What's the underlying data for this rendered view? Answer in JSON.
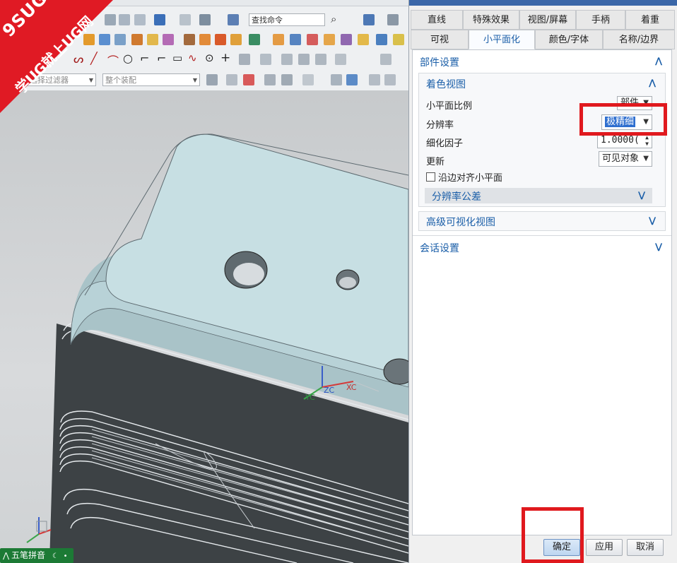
{
  "toolbar": {
    "search_command": "查找命令",
    "filter_placeholder": "选择过滤器",
    "assembly_scope": "整个装配"
  },
  "watermark": {
    "line1": "9SUG",
    "line2": "学UG就上UG网"
  },
  "viewport": {
    "axes": {
      "zc": "ZC",
      "yc": "YC",
      "xc": "XC"
    }
  },
  "ime": {
    "label": "五笔拼音"
  },
  "dialog": {
    "tabs_row1": [
      "直线",
      "特殊效果",
      "视图/屏幕",
      "手柄",
      "着重"
    ],
    "tabs_row2": [
      "可视",
      "小平面化",
      "颜色/字体",
      "名称/边界"
    ],
    "active_tab": "小平面化",
    "part_settings": {
      "title": "部件设置",
      "shaded_view": {
        "title": "着色视图",
        "facet_ratio_label": "小平面比例",
        "facet_ratio_value": "部件",
        "resolution_label": "分辨率",
        "resolution_value": "极精细",
        "refine_factor_label": "细化因子",
        "refine_factor_value": "1.0000(",
        "update_label": "更新",
        "update_value": "可见对象",
        "align_checkbox_label": "沿边对齐小平面",
        "align_checked": false,
        "tolerance_group": "分辨率公差"
      },
      "advanced_group": "高级可视化视图"
    },
    "session_settings": "会话设置",
    "buttons": {
      "ok": "确定",
      "apply": "应用",
      "cancel": "取消"
    }
  },
  "colors": {
    "accent": "#1a5ea8",
    "highlight": "#e0191e",
    "selected": "#2f6fcf",
    "model": "#c8dfe4"
  }
}
